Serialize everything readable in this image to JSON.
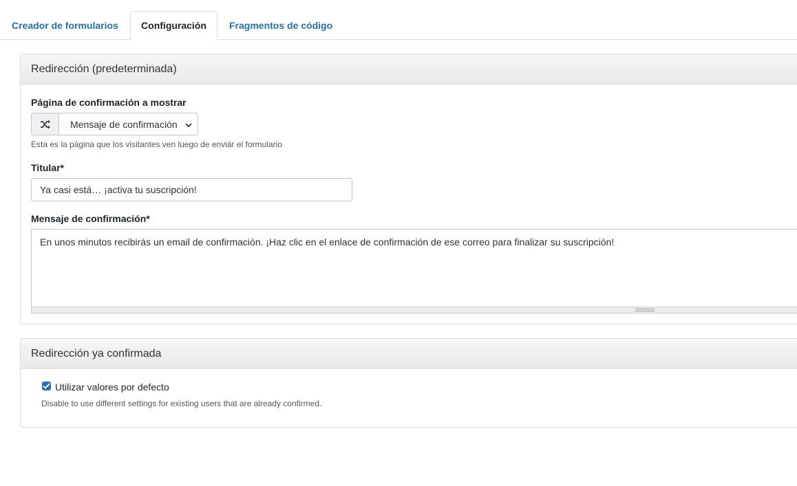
{
  "tabs": [
    {
      "label": "Creador de formularios",
      "active": false
    },
    {
      "label": "Configuración",
      "active": true
    },
    {
      "label": "Fragmentos de código",
      "active": false
    }
  ],
  "redirect_default": {
    "title": "Redirección (predeterminada)",
    "confirmation_page": {
      "label": "Página de confirmación a mostrar",
      "icon": "shuffle-icon",
      "selected": "Mensaje de confirmación",
      "help": "Esta es la página que los visitantes ven luego de enviár el formulario"
    },
    "headline": {
      "label": "Titular*",
      "value": "Ya casi está… ¡activa tu suscripción!"
    },
    "message": {
      "label": "Mensaje de confirmación*",
      "value": "En unos minutos recibirás un email de confirmación. ¡Haz clic en el enlace de confirmación de ese correo para finalizar su suscripción!"
    }
  },
  "redirect_confirmed": {
    "title": "Redirección ya confirmada",
    "use_defaults": {
      "label": "Utilizar valores por defecto",
      "checked": true,
      "help": "Disable to use different settings for existing users that are already confirmed."
    }
  },
  "colors": {
    "accent": "#2271b1",
    "border": "#dcdcde"
  }
}
